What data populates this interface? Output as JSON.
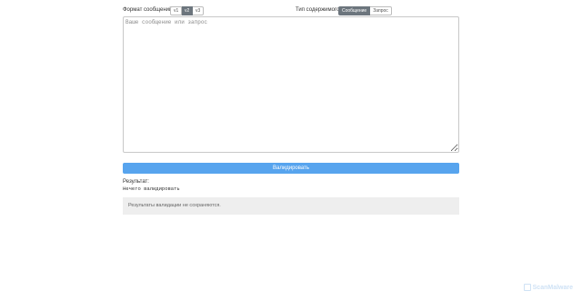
{
  "format": {
    "label": "Формат сообщений:",
    "options": [
      "v1",
      "v2",
      "v3"
    ],
    "selected": "v2"
  },
  "content_type": {
    "label": "Тип содержимого:",
    "options": [
      "Сообщение",
      "Запрос"
    ],
    "selected": "Сообщение"
  },
  "editor": {
    "placeholder": "Ваше сообщение или запрос",
    "value": ""
  },
  "actions": {
    "validate_label": "Валидировать"
  },
  "result": {
    "label": "Результат:",
    "value": "Нечего валидировать",
    "note": "Результаты валидации не сохраняются."
  },
  "watermark": {
    "text": "ScanMalware"
  },
  "colors": {
    "accent": "#57a4ee",
    "active_button": "#6c757d",
    "note_background": "#eeeeee"
  }
}
